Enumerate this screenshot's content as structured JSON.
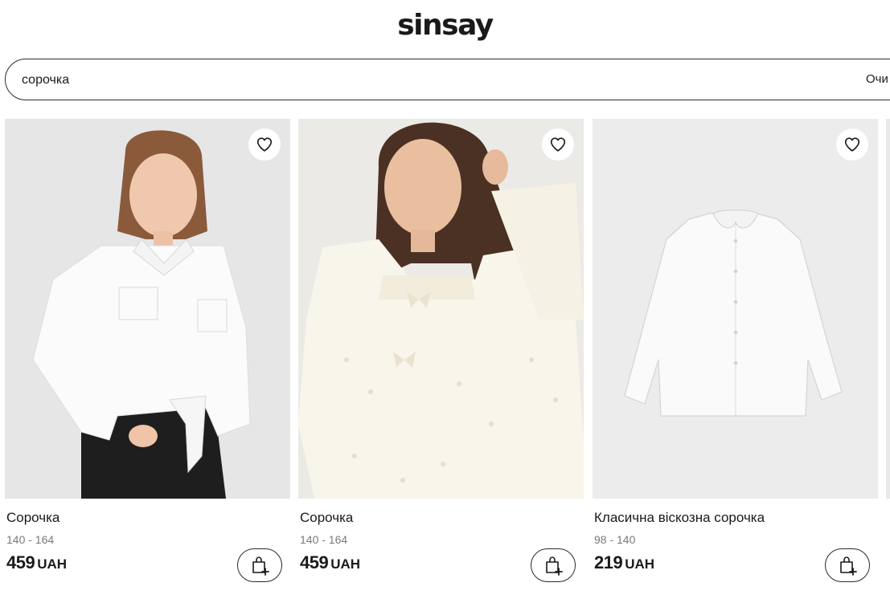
{
  "header": {
    "logo": "sinsay"
  },
  "search": {
    "value": "сорочка",
    "clear_label": "Очи"
  },
  "products": [
    {
      "name": "Сорочка",
      "sizes": "140 - 164",
      "price": "459",
      "currency": "UAH",
      "image_bg": "#e6e6e7"
    },
    {
      "name": "Сорочка",
      "sizes": "140 - 164",
      "price": "459",
      "currency": "UAH",
      "image_bg": "#eceae6"
    },
    {
      "name": "Класична віскозна сорочка",
      "sizes": "98 - 140",
      "price": "219",
      "currency": "UAH",
      "image_bg": "#ececec"
    }
  ],
  "icons": {
    "favorite": "heart-icon",
    "add_to_cart": "shopping-bag-plus-icon"
  }
}
